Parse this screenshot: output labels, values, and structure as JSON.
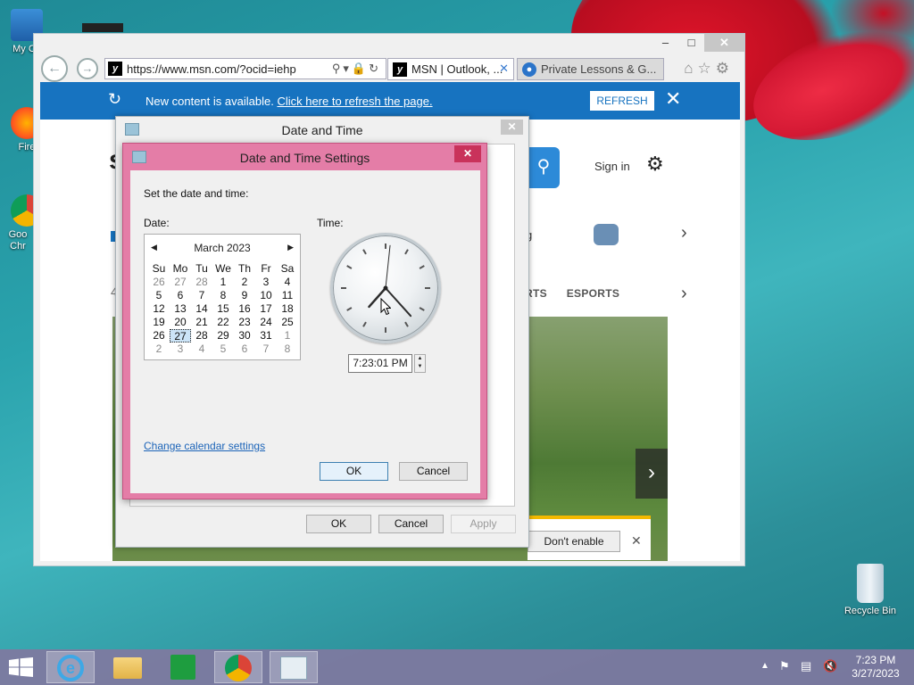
{
  "desktop": {
    "icons": [
      {
        "label": "My Co",
        "name": "my-computer"
      },
      {
        "label": "Fire",
        "name": "firefox"
      },
      {
        "label": "Goo Chr",
        "name": "google-chrome"
      },
      {
        "label": "Recycle Bin",
        "name": "recycle-bin"
      }
    ]
  },
  "browser": {
    "url": "https://www.msn.com/?ocid=iehp",
    "tabs": [
      {
        "label": "MSN | Outlook, ..."
      },
      {
        "label": "Private Lessons & G..."
      }
    ],
    "notification": {
      "message": "New content is available.",
      "link": "Click here to refresh the page.",
      "button": "REFRESH"
    },
    "page": {
      "sign_in": "Sign in",
      "nav_item": "g",
      "nav_categories": [
        "RTS",
        "ESPORTS"
      ],
      "left_text": "4",
      "dont_enable": "Don't enable",
      "partial_text": "e"
    }
  },
  "date_time_dialog": {
    "title": "Date and Time",
    "buttons": {
      "ok": "OK",
      "cancel": "Cancel",
      "apply": "Apply"
    }
  },
  "settings_dialog": {
    "title": "Date and Time Settings",
    "instruction": "Set the date and time:",
    "date_label": "Date:",
    "time_label": "Time:",
    "calendar": {
      "month": "March 2023",
      "weekdays": [
        "Su",
        "Mo",
        "Tu",
        "We",
        "Th",
        "Fr",
        "Sa"
      ],
      "weeks": [
        [
          "26",
          "27",
          "28",
          "1",
          "2",
          "3",
          "4"
        ],
        [
          "5",
          "6",
          "7",
          "8",
          "9",
          "10",
          "11"
        ],
        [
          "12",
          "13",
          "14",
          "15",
          "16",
          "17",
          "18"
        ],
        [
          "19",
          "20",
          "21",
          "22",
          "23",
          "24",
          "25"
        ],
        [
          "26",
          "27",
          "28",
          "29",
          "30",
          "31",
          "1"
        ],
        [
          "2",
          "3",
          "4",
          "5",
          "6",
          "7",
          "8"
        ]
      ],
      "selected": "27"
    },
    "clock": {
      "hour": 7,
      "minute": 23,
      "second": 1
    },
    "time_value": "7:23:01 PM",
    "change_calendar_link": "Change calendar settings",
    "buttons": {
      "ok": "OK",
      "cancel": "Cancel"
    }
  },
  "taskbar": {
    "time": "7:23 PM",
    "date": "3/27/2023"
  }
}
